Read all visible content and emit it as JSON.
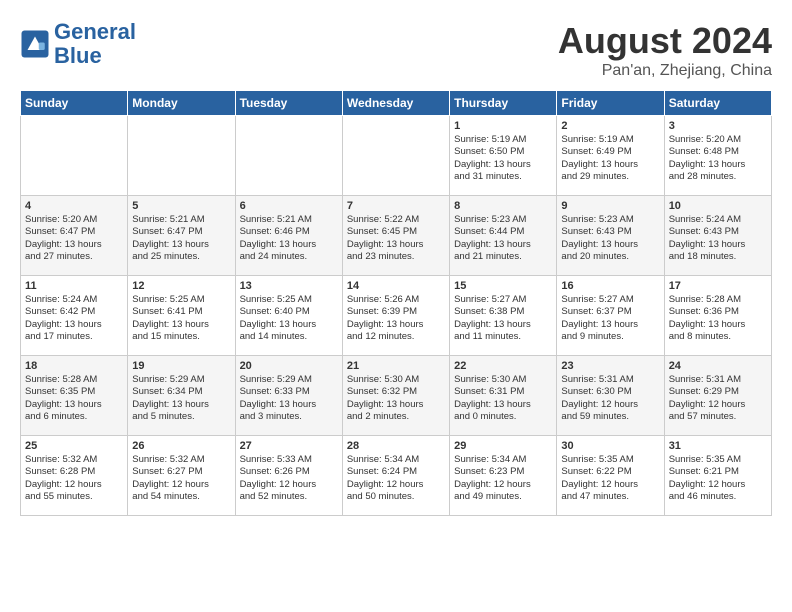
{
  "header": {
    "logo_line1": "General",
    "logo_line2": "Blue",
    "month": "August 2024",
    "location": "Pan'an, Zhejiang, China"
  },
  "days_of_week": [
    "Sunday",
    "Monday",
    "Tuesday",
    "Wednesday",
    "Thursday",
    "Friday",
    "Saturday"
  ],
  "weeks": [
    [
      {
        "day": "",
        "content": ""
      },
      {
        "day": "",
        "content": ""
      },
      {
        "day": "",
        "content": ""
      },
      {
        "day": "",
        "content": ""
      },
      {
        "day": "1",
        "content": "Sunrise: 5:19 AM\nSunset: 6:50 PM\nDaylight: 13 hours\nand 31 minutes."
      },
      {
        "day": "2",
        "content": "Sunrise: 5:19 AM\nSunset: 6:49 PM\nDaylight: 13 hours\nand 29 minutes."
      },
      {
        "day": "3",
        "content": "Sunrise: 5:20 AM\nSunset: 6:48 PM\nDaylight: 13 hours\nand 28 minutes."
      }
    ],
    [
      {
        "day": "4",
        "content": "Sunrise: 5:20 AM\nSunset: 6:47 PM\nDaylight: 13 hours\nand 27 minutes."
      },
      {
        "day": "5",
        "content": "Sunrise: 5:21 AM\nSunset: 6:47 PM\nDaylight: 13 hours\nand 25 minutes."
      },
      {
        "day": "6",
        "content": "Sunrise: 5:21 AM\nSunset: 6:46 PM\nDaylight: 13 hours\nand 24 minutes."
      },
      {
        "day": "7",
        "content": "Sunrise: 5:22 AM\nSunset: 6:45 PM\nDaylight: 13 hours\nand 23 minutes."
      },
      {
        "day": "8",
        "content": "Sunrise: 5:23 AM\nSunset: 6:44 PM\nDaylight: 13 hours\nand 21 minutes."
      },
      {
        "day": "9",
        "content": "Sunrise: 5:23 AM\nSunset: 6:43 PM\nDaylight: 13 hours\nand 20 minutes."
      },
      {
        "day": "10",
        "content": "Sunrise: 5:24 AM\nSunset: 6:43 PM\nDaylight: 13 hours\nand 18 minutes."
      }
    ],
    [
      {
        "day": "11",
        "content": "Sunrise: 5:24 AM\nSunset: 6:42 PM\nDaylight: 13 hours\nand 17 minutes."
      },
      {
        "day": "12",
        "content": "Sunrise: 5:25 AM\nSunset: 6:41 PM\nDaylight: 13 hours\nand 15 minutes."
      },
      {
        "day": "13",
        "content": "Sunrise: 5:25 AM\nSunset: 6:40 PM\nDaylight: 13 hours\nand 14 minutes."
      },
      {
        "day": "14",
        "content": "Sunrise: 5:26 AM\nSunset: 6:39 PM\nDaylight: 13 hours\nand 12 minutes."
      },
      {
        "day": "15",
        "content": "Sunrise: 5:27 AM\nSunset: 6:38 PM\nDaylight: 13 hours\nand 11 minutes."
      },
      {
        "day": "16",
        "content": "Sunrise: 5:27 AM\nSunset: 6:37 PM\nDaylight: 13 hours\nand 9 minutes."
      },
      {
        "day": "17",
        "content": "Sunrise: 5:28 AM\nSunset: 6:36 PM\nDaylight: 13 hours\nand 8 minutes."
      }
    ],
    [
      {
        "day": "18",
        "content": "Sunrise: 5:28 AM\nSunset: 6:35 PM\nDaylight: 13 hours\nand 6 minutes."
      },
      {
        "day": "19",
        "content": "Sunrise: 5:29 AM\nSunset: 6:34 PM\nDaylight: 13 hours\nand 5 minutes."
      },
      {
        "day": "20",
        "content": "Sunrise: 5:29 AM\nSunset: 6:33 PM\nDaylight: 13 hours\nand 3 minutes."
      },
      {
        "day": "21",
        "content": "Sunrise: 5:30 AM\nSunset: 6:32 PM\nDaylight: 13 hours\nand 2 minutes."
      },
      {
        "day": "22",
        "content": "Sunrise: 5:30 AM\nSunset: 6:31 PM\nDaylight: 13 hours\nand 0 minutes."
      },
      {
        "day": "23",
        "content": "Sunrise: 5:31 AM\nSunset: 6:30 PM\nDaylight: 12 hours\nand 59 minutes."
      },
      {
        "day": "24",
        "content": "Sunrise: 5:31 AM\nSunset: 6:29 PM\nDaylight: 12 hours\nand 57 minutes."
      }
    ],
    [
      {
        "day": "25",
        "content": "Sunrise: 5:32 AM\nSunset: 6:28 PM\nDaylight: 12 hours\nand 55 minutes."
      },
      {
        "day": "26",
        "content": "Sunrise: 5:32 AM\nSunset: 6:27 PM\nDaylight: 12 hours\nand 54 minutes."
      },
      {
        "day": "27",
        "content": "Sunrise: 5:33 AM\nSunset: 6:26 PM\nDaylight: 12 hours\nand 52 minutes."
      },
      {
        "day": "28",
        "content": "Sunrise: 5:34 AM\nSunset: 6:24 PM\nDaylight: 12 hours\nand 50 minutes."
      },
      {
        "day": "29",
        "content": "Sunrise: 5:34 AM\nSunset: 6:23 PM\nDaylight: 12 hours\nand 49 minutes."
      },
      {
        "day": "30",
        "content": "Sunrise: 5:35 AM\nSunset: 6:22 PM\nDaylight: 12 hours\nand 47 minutes."
      },
      {
        "day": "31",
        "content": "Sunrise: 5:35 AM\nSunset: 6:21 PM\nDaylight: 12 hours\nand 46 minutes."
      }
    ]
  ]
}
